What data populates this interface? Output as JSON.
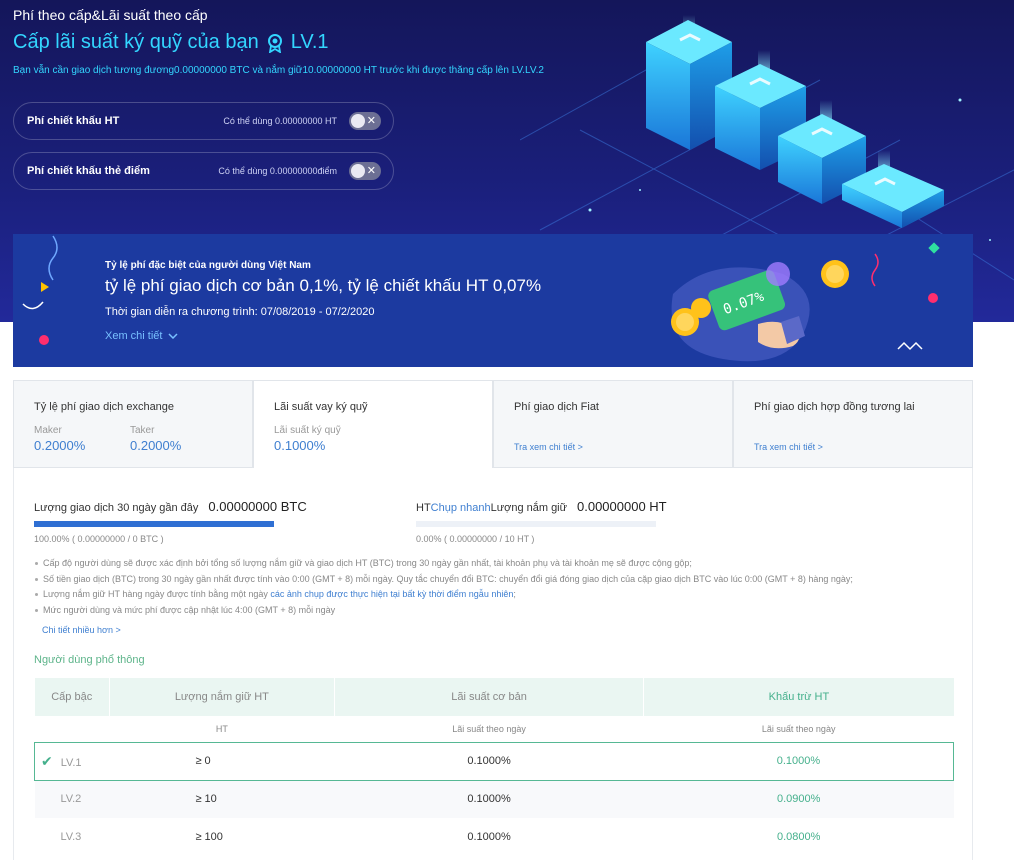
{
  "hero": {
    "breadcrumb": "Phí theo cấp&Lãi suất theo cấp",
    "title": "Cấp lãi suất ký quỹ của bạn",
    "level": "LV.1",
    "subtitle": "Bạn vẫn cần giao dịch tương đương0.00000000 BTC và nắm giữ10.00000000 HT trước khi được thăng cấp lên LV.LV.2",
    "toggles": [
      {
        "label": "Phí chiết khấu HT",
        "available": "Có thể dùng 0.00000000 HT"
      },
      {
        "label": "Phí chiết khấu thẻ điểm",
        "available": "Có thể dùng 0.00000000điểm"
      }
    ]
  },
  "banner": {
    "title": "Tỷ lệ phí đặc biệt của người dùng Việt Nam",
    "main": "tỷ lệ phí giao dịch cơ bản 0,1%, tỷ lệ chiết khấu HT 0,07%",
    "time": "Thời gian diễn ra chương trình: 07/08/2019 - 07/2/2020",
    "more": "Xem chi tiết",
    "card_text": "0.07%"
  },
  "tabs": [
    {
      "title": "Tỷ lệ phí giao dịch exchange",
      "maker_label": "Maker",
      "maker_value": "0.2000%",
      "taker_label": "Taker",
      "taker_value": "0.2000%"
    },
    {
      "title": "Lãi suất vay ký quỹ",
      "label": "Lãi suất ký quỹ",
      "value": "0.1000%"
    },
    {
      "title": "Phí giao dịch Fiat",
      "link": "Tra xem chi tiết >"
    },
    {
      "title": "Phí giao dịch hợp đồng tương lai",
      "link": "Tra xem chi tiết >"
    }
  ],
  "progress": {
    "trade": {
      "label": "Lượng giao dịch 30 ngày gần đây",
      "value": "0.00000000 BTC",
      "percent": 100,
      "foot": "100.00%  ( 0.00000000 / 0 BTC )"
    },
    "hold": {
      "label_prefix": "HT",
      "label_link": "Chụp nhanh",
      "label_suffix": "Lượng nắm giữ",
      "value": "0.00000000 HT",
      "percent": 0,
      "foot": "0.00%  ( 0.00000000 / 10 HT )"
    }
  },
  "notes": [
    {
      "text": "Cấp độ người dùng sẽ được xác định bởi tổng số lượng nắm giữ và giao dịch HT (BTC) trong 30 ngày gần nhất, tài khoản phụ và tài khoản mẹ sẽ được cộng gộp;"
    },
    {
      "text": "Số tiền giao dịch (BTC) trong 30 ngày gần nhất được tính vào 0:00 (GMT + 8) mỗi ngày. Quy tắc chuyển đổi BTC: chuyển đổi giá đóng giao dịch của cặp giao dịch BTC vào lúc 0:00 (GMT + 8) hàng ngày;"
    },
    {
      "text": "Lượng nắm giữ HT hàng ngày được tính bằng một ngày ",
      "highlight": "các ảnh chụp được thực hiện tại bất kỳ thời điểm ngẫu nhiên",
      "after": ";"
    },
    {
      "text": "Mức người dùng và mức phí được cập nhật lúc 4:00 (GMT + 8) mỗi ngày"
    }
  ],
  "more_link": "Chi tiết nhiều hơn >",
  "section_title": "Người dùng phổ thông",
  "table": {
    "headers": [
      "Cấp bậc",
      "Lượng nắm giữ HT",
      "Lãi suất cơ bản",
      "Khấu trừ HT"
    ],
    "subheaders": [
      "",
      "HT",
      "Lãi suất theo ngày",
      "Lãi suất theo ngày"
    ],
    "rows": [
      {
        "level": "LV.1",
        "hold": "≥ 0",
        "base": "0.1000%",
        "discount": "0.1000%"
      },
      {
        "level": "LV.2",
        "hold": "≥ 10",
        "base": "0.1000%",
        "discount": "0.0900%"
      },
      {
        "level": "LV.3",
        "hold": "≥ 100",
        "base": "0.1000%",
        "discount": "0.0800%"
      }
    ]
  },
  "colors": {
    "accent": "#33d6ff",
    "green": "#45b08c",
    "link": "#3f7fd0",
    "banner": "#1c3aa0"
  }
}
